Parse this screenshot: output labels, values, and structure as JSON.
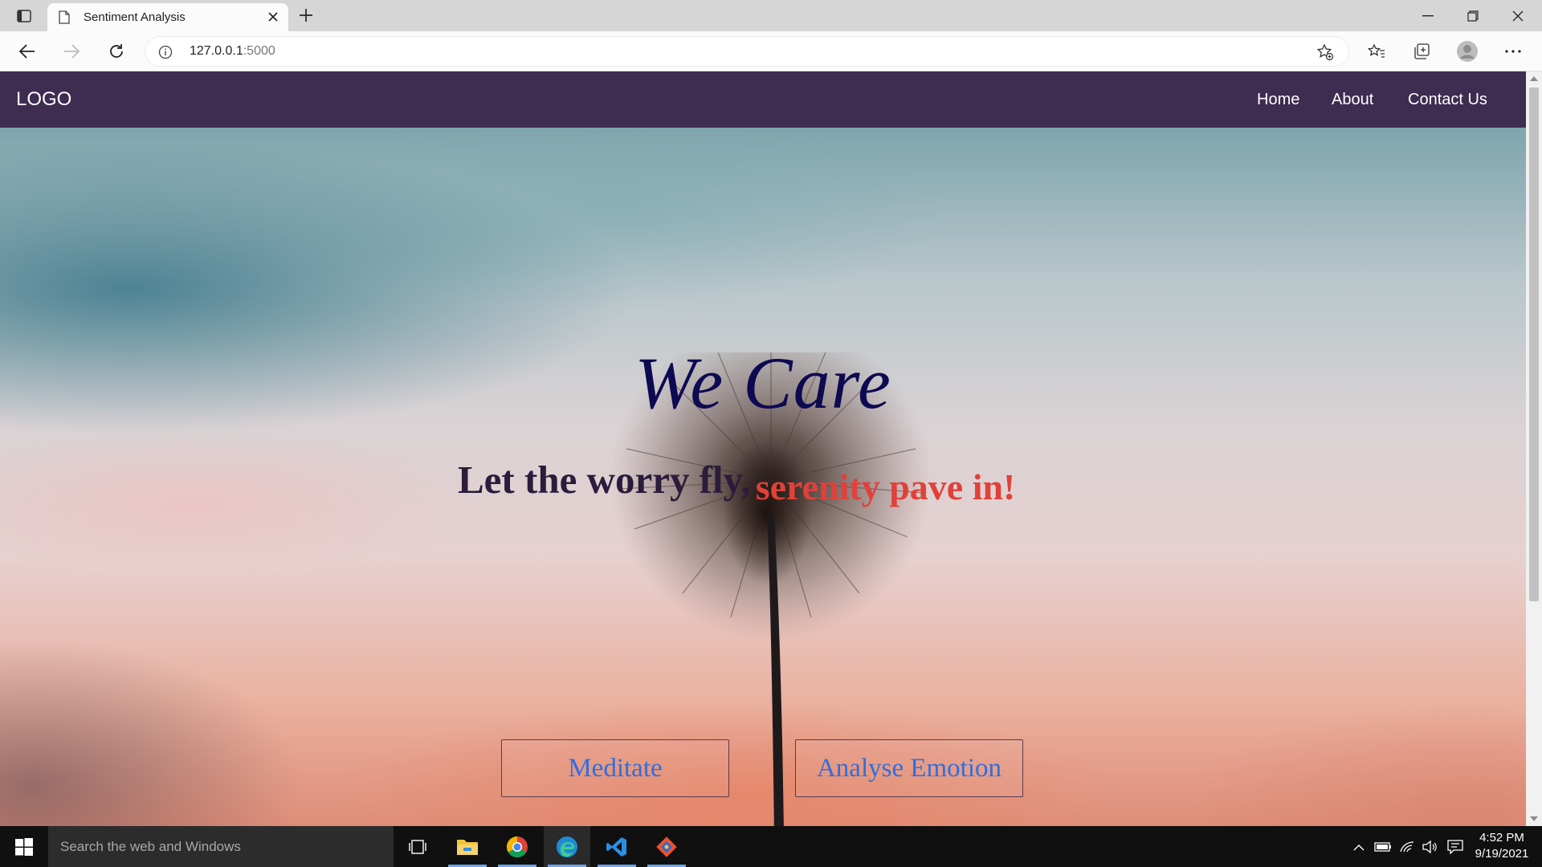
{
  "browser": {
    "tab_title": "Sentiment Analysis",
    "address": {
      "host": "127.0.0.1",
      "port": ":5000"
    }
  },
  "site": {
    "logo": "LOGO",
    "nav": [
      {
        "label": "Home"
      },
      {
        "label": "About"
      },
      {
        "label": "Contact Us"
      }
    ],
    "hero": {
      "title": "We Care",
      "subtitle_part1": "Let the worry fly,",
      "subtitle_part2": "serenity pave in!",
      "buttons": [
        {
          "label": "Meditate"
        },
        {
          "label": "Analyse Emotion"
        }
      ]
    },
    "colors": {
      "navbar": "#3e2c51",
      "title": "#0d0a52",
      "subtitle_dark": "#2a1c3a",
      "subtitle_accent": "#e0413a",
      "button_text": "#2f6ee0"
    }
  },
  "taskbar": {
    "search_placeholder": "Search the web and Windows",
    "apps": [
      "task-view-icon",
      "file-explorer-icon",
      "chrome-icon",
      "edge-icon",
      "vscode-icon",
      "git-icon"
    ],
    "time": "4:52 PM",
    "date": "9/19/2021"
  }
}
